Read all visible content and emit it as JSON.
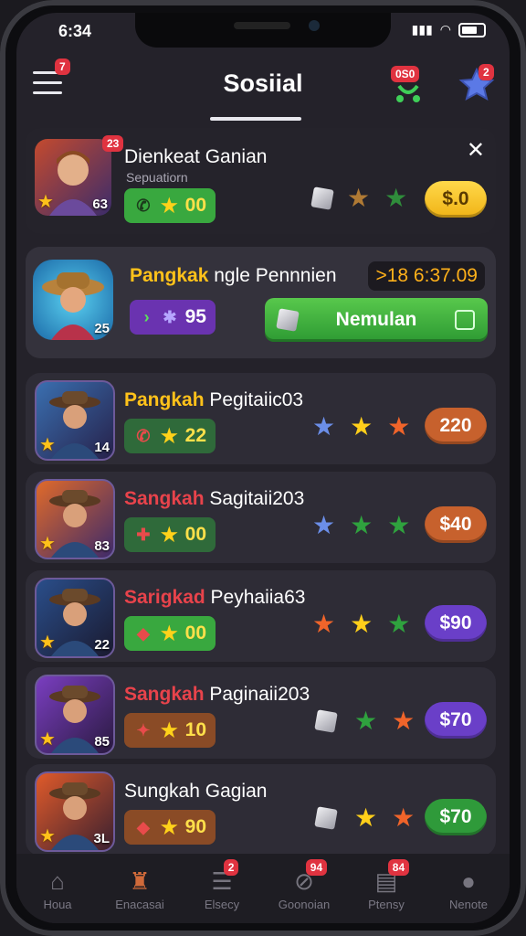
{
  "status_bar": {
    "time": "6:34"
  },
  "header": {
    "title": "Sosiial",
    "menu_badge": "7",
    "controller_badge": "0S0",
    "star_badge": "2"
  },
  "colors": {
    "accent_yellow": "#ffc21a",
    "accent_red": "#e8434b",
    "green": "#3fb24a",
    "purple": "#6a3fc8",
    "orange": "#c7612d"
  },
  "featured": {
    "name": "Dienkeat Ganian",
    "subtitle": "Sepuatiorn",
    "avatar_badge": "23",
    "level": "63",
    "pill_value": "00",
    "price": "$.0",
    "gems": [
      "cube",
      "bronze-star",
      "green-star"
    ]
  },
  "promo": {
    "name_highlight": "Pangkak",
    "name_rest": " ngle Pennnien",
    "timer": ">18 6:37.09",
    "level": "25",
    "pill_value": "95",
    "button_label": "Nemulan"
  },
  "players": [
    {
      "highlight": "Pangkah",
      "rest": " Pegitaiic03",
      "hl_color": "yellow",
      "level": "14",
      "pill_value": "22",
      "pill_icon": "phone",
      "pill_color": "#2f6a3a",
      "price": "220",
      "price_color": "#c7612d",
      "gems": [
        "blue-star",
        "yellow-star",
        "orange-star"
      ]
    },
    {
      "highlight": "Sangkah",
      "rest": " Sagitaii203",
      "hl_color": "red",
      "level": "83",
      "pill_value": "00",
      "pill_icon": "candy",
      "pill_color": "#2f6a3a",
      "price": "$40",
      "price_color": "#c7612d",
      "gems": [
        "blue-star",
        "green-star",
        "green-star"
      ]
    },
    {
      "highlight": "Sarigkad",
      "rest": " Peyhaiia63",
      "hl_color": "red",
      "level": "22",
      "pill_value": "00",
      "pill_icon": "gem",
      "pill_color": "#39a83f",
      "price": "$90",
      "price_color": "#6a3fc8",
      "gems": [
        "orange-star",
        "yellow-star",
        "green-star"
      ]
    },
    {
      "highlight": "Sangkah",
      "rest": " Paginaii203",
      "hl_color": "red",
      "level": "85",
      "pill_value": "10",
      "pill_icon": "shield",
      "pill_color": "#8a4b26",
      "price": "$70",
      "price_color": "#6a3fc8",
      "gems": [
        "cube",
        "green-star",
        "orange-star"
      ]
    },
    {
      "highlight": "",
      "rest": "Sungkah Gagian",
      "hl_color": "none",
      "level": "3L",
      "pill_value": "90",
      "pill_icon": "gem",
      "pill_color": "#8a4b26",
      "price": "$70",
      "price_color": "#2f9a3a",
      "gems": [
        "cube",
        "yellow-star",
        "orange-star"
      ]
    }
  ],
  "bottom_nav": [
    {
      "label": "Houa",
      "icon": "home-icon",
      "badge": ""
    },
    {
      "label": "Enacasai",
      "icon": "robot-icon",
      "badge": ""
    },
    {
      "label": "Elsecy",
      "icon": "list-icon",
      "badge": "2"
    },
    {
      "label": "Goonoian",
      "icon": "satellite-icon",
      "badge": "94"
    },
    {
      "label": "Ptensy",
      "icon": "chart-icon",
      "badge": "84"
    },
    {
      "label": "Nenote",
      "icon": "user-icon",
      "badge": ""
    }
  ]
}
